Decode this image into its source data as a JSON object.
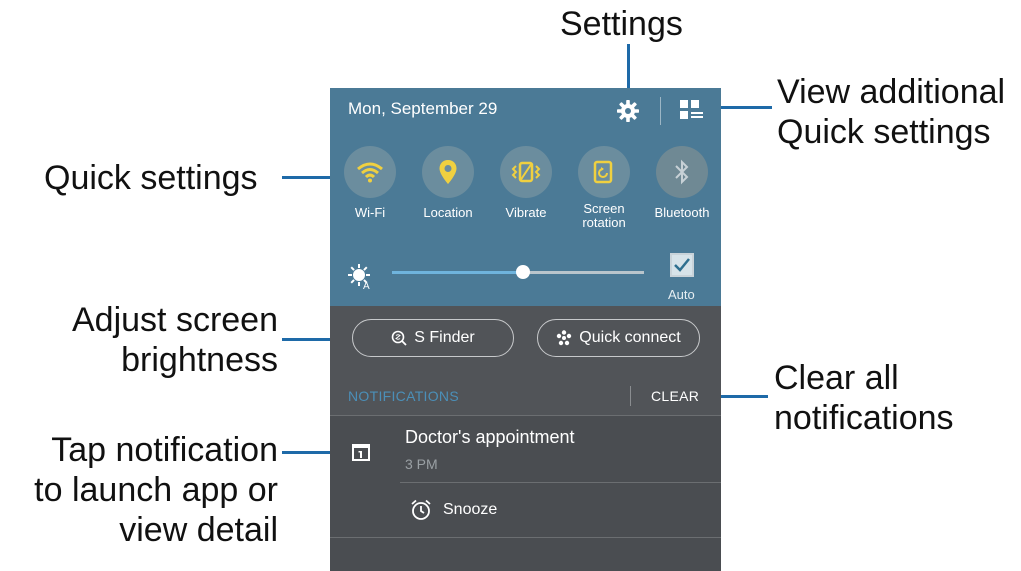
{
  "callouts": {
    "settings": "Settings",
    "view_additional_1": "View additional",
    "view_additional_2": "Quick settings",
    "quick_settings": "Quick settings",
    "adjust_1": "Adjust screen",
    "adjust_2": "brightness",
    "clear_1": "Clear all",
    "clear_2": "notifications",
    "tap_1": "Tap notification",
    "tap_2": "to launch app or",
    "tap_3": "view detail"
  },
  "panel": {
    "date": "Mon, September 29",
    "tiles": [
      {
        "label": "Wi-Fi",
        "icon": "wifi-icon",
        "state": "on"
      },
      {
        "label": "Location",
        "icon": "location-icon",
        "state": "on"
      },
      {
        "label": "Vibrate",
        "icon": "vibrate-icon",
        "state": "on"
      },
      {
        "label_line1": "Screen",
        "label_line2": "rotation",
        "icon": "screen-rotation-icon",
        "state": "on"
      },
      {
        "label": "Bluetooth",
        "icon": "bluetooth-icon",
        "state": "off"
      }
    ],
    "brightness": {
      "level": 0.52,
      "auto_label": "Auto",
      "auto_checked": true
    },
    "buttons": {
      "s_finder": "S Finder",
      "quick_connect": "Quick connect"
    },
    "notifications_header": "NOTIFICATIONS",
    "clear_label": "CLEAR",
    "notification": {
      "title": "Doctor's appointment",
      "time": "3 PM",
      "action": "Snooze"
    }
  },
  "colors": {
    "panel_top": "#4b7a96",
    "panel_bottom": "#515458",
    "tile_active_icon": "#f0d040",
    "accent_line": "#1e6aa8",
    "slider_fill": "#6fb4dd"
  }
}
